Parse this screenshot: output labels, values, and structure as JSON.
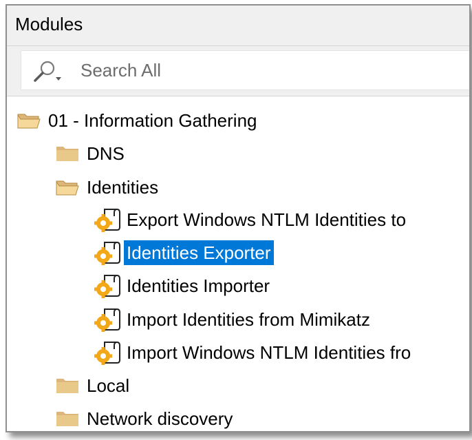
{
  "panel": {
    "title": "Modules"
  },
  "search": {
    "placeholder": "Search All",
    "value": ""
  },
  "tree": {
    "items": [
      {
        "label": "01 - Information Gathering",
        "icon": "folder-open-icon",
        "level": 0,
        "selected": false
      },
      {
        "label": "DNS",
        "icon": "folder-closed-icon",
        "level": 1,
        "selected": false
      },
      {
        "label": "Identities",
        "icon": "folder-open-icon",
        "level": 1,
        "selected": false
      },
      {
        "label": "Export Windows NTLM Identities to",
        "icon": "module-script-icon",
        "level": 2,
        "selected": false
      },
      {
        "label": "Identities Exporter",
        "icon": "module-script-icon",
        "level": 2,
        "selected": true
      },
      {
        "label": "Identities Importer",
        "icon": "module-script-icon",
        "level": 2,
        "selected": false
      },
      {
        "label": "Import Identities from Mimikatz",
        "icon": "module-script-icon",
        "level": 2,
        "selected": false
      },
      {
        "label": "Import Windows NTLM Identities fro",
        "icon": "module-script-icon",
        "level": 2,
        "selected": false
      },
      {
        "label": "Local",
        "icon": "folder-closed-icon",
        "level": 1,
        "selected": false
      },
      {
        "label": "Network discovery",
        "icon": "folder-closed-icon",
        "level": 1,
        "selected": false
      }
    ]
  },
  "colors": {
    "selection": "#0078d7",
    "folder": "#dcb67a",
    "gear": "#f2a818"
  }
}
